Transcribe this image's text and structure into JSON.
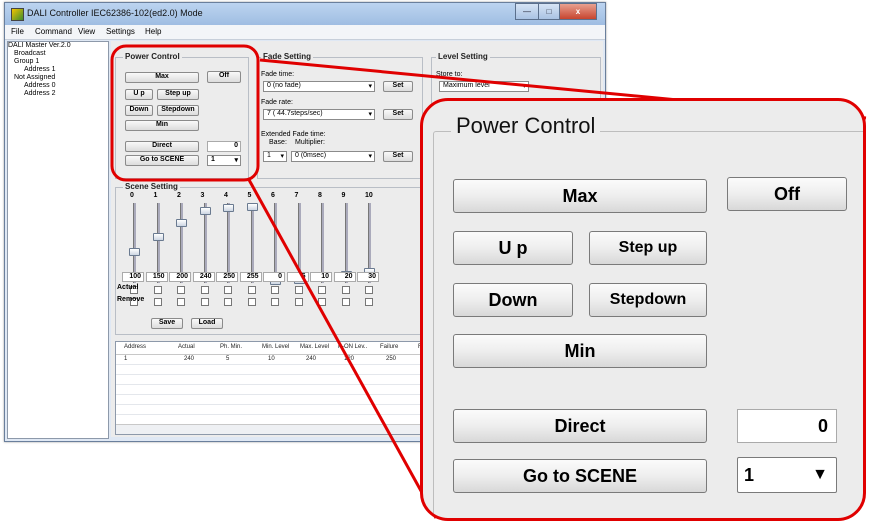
{
  "window": {
    "title": "DALI Controller IEC62386-102(ed2.0) Mode",
    "controls": {
      "minimize": "—",
      "maximize": "□",
      "close": "x"
    }
  },
  "menu": [
    "File",
    "Command",
    "View",
    "Settings",
    "Help"
  ],
  "tree": {
    "root": "DALI Master Ver.2.0",
    "items": [
      "Broadcast",
      "Group 1",
      "Address 1",
      "Not Assigned",
      "Address 0",
      "Address 2"
    ]
  },
  "power_control": {
    "title": "Power Control",
    "max": "Max",
    "off": "Off",
    "up": "U p",
    "step_up": "Step up",
    "down": "Down",
    "step_down": "Stepdown",
    "min": "Min",
    "direct": "Direct",
    "direct_value": "0",
    "go_to_scene": "Go to SCENE",
    "scene_value": "1"
  },
  "fade_setting": {
    "title": "Fade Setting",
    "fade_time_label": "Fade time:",
    "fade_time_value": "0 (no fade)",
    "fade_rate_label": "Fade rate:",
    "fade_rate_value": "7 ( 44.7steps/sec)",
    "extended_label": "Extended Fade time:",
    "base_label": "Base:",
    "multiplier_label": "Multiplier:",
    "base_value": "1",
    "multiplier_value": "0 (0msec)",
    "set": "Set"
  },
  "level_setting": {
    "title": "Level Setting",
    "store_to_label": "Store to:",
    "store_to_value": "Maximum level"
  },
  "scene_setting": {
    "title": "Scene Setting",
    "scenes": [
      {
        "n": "0",
        "value": "100",
        "level": 0.39
      },
      {
        "n": "1",
        "value": "150",
        "level": 0.59
      },
      {
        "n": "2",
        "value": "200",
        "level": 0.78
      },
      {
        "n": "3",
        "value": "240",
        "level": 0.94
      },
      {
        "n": "4",
        "value": "250",
        "level": 0.98
      },
      {
        "n": "5",
        "value": "255",
        "level": 1.0
      },
      {
        "n": "6",
        "value": "0",
        "level": 0.0
      },
      {
        "n": "7",
        "value": "5",
        "level": 0.02
      },
      {
        "n": "8",
        "value": "10",
        "level": 0.04
      },
      {
        "n": "9",
        "value": "20",
        "level": 0.08
      },
      {
        "n": "10",
        "value": "30",
        "level": 0.12
      }
    ],
    "actual_label": "Actual",
    "remove_label": "Remove",
    "save": "Save",
    "load": "Load"
  },
  "table": {
    "headers": [
      "Address",
      "Actual",
      "Ph. Min.",
      "Min. Level",
      "Max. Level",
      "P-ON Lev..",
      "Failure",
      "Fade"
    ],
    "rows": [
      [
        "1",
        "240",
        "5",
        "10",
        "240",
        "120",
        "250",
        ""
      ]
    ]
  },
  "colors": {
    "callout_border": "#e00000"
  }
}
